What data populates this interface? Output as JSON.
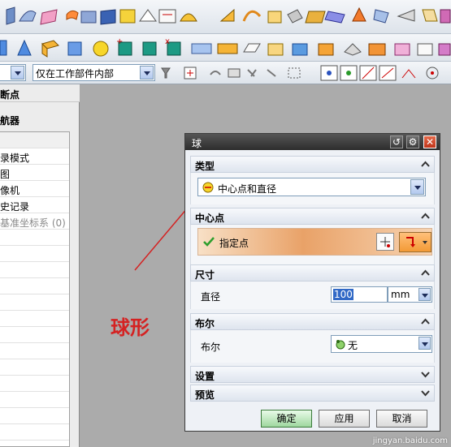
{
  "toolbar": {
    "selection_filter": "",
    "scope_filter": "仅在工作部件内部"
  },
  "left_panel": {
    "header": "断点",
    "title": "航器",
    "items": [
      "录模式",
      "图",
      "像机",
      "史记录",
      "基准坐标系 (0)"
    ]
  },
  "annotation": {
    "text": "球形",
    "color": "#d42222"
  },
  "dialog": {
    "title": "球",
    "sections": {
      "type": {
        "label": "类型",
        "value": "中心点和直径"
      },
      "center": {
        "label": "中心点",
        "point_label": "指定点"
      },
      "size": {
        "label": "尺寸",
        "field_label": "直径",
        "value": "100",
        "unit": "mm"
      },
      "boolean": {
        "label": "布尔",
        "field_label": "布尔",
        "value": "无"
      },
      "settings": {
        "label": "设置"
      },
      "preview": {
        "label": "预览"
      }
    },
    "buttons": {
      "ok": "确定",
      "apply": "应用",
      "cancel": "取消"
    }
  },
  "watermark": "jingyan.baidu.com",
  "colors": {
    "title_bar": "#2d2d2d",
    "accent_orange": "#e9a268",
    "annotation_red": "#d42222"
  }
}
